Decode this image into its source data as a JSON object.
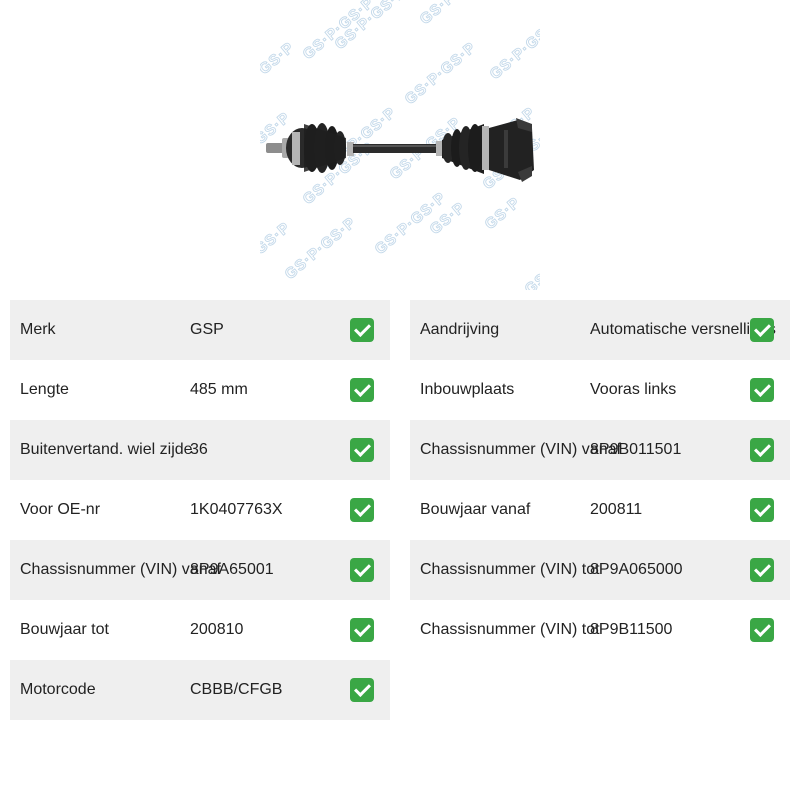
{
  "product": {
    "image_name": "drive-shaft-image",
    "watermark_text": "GS·P"
  },
  "specs_left": [
    {
      "label": "Merk",
      "value": "GSP"
    },
    {
      "label": "Lengte",
      "value": "485 mm"
    },
    {
      "label": "Buitenvertand. wiel zijde",
      "value": "36"
    },
    {
      "label": "Voor OE-nr",
      "value": "1K0407763X"
    },
    {
      "label": "Chassisnummer (VIN) vanaf",
      "value": "8P9A65001"
    },
    {
      "label": "Bouwjaar tot",
      "value": "200810"
    },
    {
      "label": "Motorcode",
      "value": "CBBB/CFGB"
    }
  ],
  "specs_right": [
    {
      "label": "Aandrijving",
      "value": "Automatische versnellings"
    },
    {
      "label": "Inbouwplaats",
      "value": "Vooras links"
    },
    {
      "label": "Chassisnummer (VIN) vanaf",
      "value": "8P9B011501"
    },
    {
      "label": "Bouwjaar vanaf",
      "value": "200811"
    },
    {
      "label": "Chassisnummer (VIN) tot",
      "value": "8P9A065000"
    },
    {
      "label": "Chassisnummer (VIN) tot",
      "value": "8P9B11500"
    }
  ],
  "check_icon": "check-mark-icon",
  "colors": {
    "row_shade": "#efefef",
    "check_green": "#3aa745",
    "watermark": "#c4d9ea"
  }
}
